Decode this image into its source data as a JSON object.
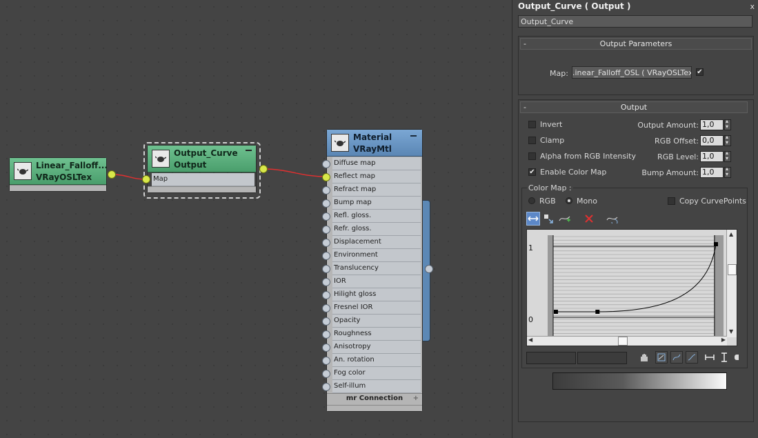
{
  "nodes": {
    "linear_falloff": {
      "title": "Linear_Falloff...",
      "subtitle": "VRayOSLTex"
    },
    "output_curve": {
      "title": "Output_Curve",
      "subtitle": "Output",
      "slots": [
        "Map"
      ]
    },
    "material": {
      "title": "Material",
      "subtitle": "VRayMtl",
      "slots": [
        "Diffuse map",
        "Reflect map",
        "Refract map",
        "Bump map",
        "Refl. gloss.",
        "Refr. gloss.",
        "Displacement",
        "Environment",
        "Translucency",
        "IOR",
        "Hilight gloss",
        "Fresnel IOR",
        "Opacity",
        "Roughness",
        "Anisotropy",
        "An. rotation",
        "Fog color",
        "Self-illum"
      ],
      "footer": "mr Connection",
      "footer_plus": "+"
    }
  },
  "panel": {
    "title": "Output_Curve  ( Output )",
    "close": "x",
    "name_value": "Output_Curve",
    "output_parameters": {
      "header": "Output Parameters",
      "collapse": "-",
      "map_label": "Map:",
      "map_value": ".inear_Falloff_OSL  ( VRayOSLTex )",
      "map_enabled": "✔"
    },
    "output": {
      "header": "Output",
      "collapse": "-",
      "checks": [
        {
          "label": "Invert",
          "checked": ""
        },
        {
          "label": "Clamp",
          "checked": ""
        },
        {
          "label": "Alpha from RGB Intensity",
          "checked": ""
        },
        {
          "label": "Enable Color Map",
          "checked": "✔"
        }
      ],
      "spinners": [
        {
          "label": "Output Amount:",
          "value": "1,0"
        },
        {
          "label": "RGB Offset:",
          "value": "0,0"
        },
        {
          "label": "RGB Level:",
          "value": "1,0"
        },
        {
          "label": "Bump Amount:",
          "value": "1,0"
        }
      ]
    },
    "color_map": {
      "label": "Color Map :",
      "rgb_label": "RGB",
      "mono_label": "Mono",
      "selected_mode": "Mono",
      "copy_label": "Copy CurvePoints",
      "y_top": "1",
      "y_bottom": "0",
      "curve_points": [
        [
          0.0,
          0.0
        ],
        [
          0.26,
          0.0
        ],
        [
          1.0,
          1.0
        ]
      ]
    }
  },
  "colors": {
    "wire": "#e03030",
    "node_green": "#5aae7c",
    "node_blue": "#5c88b5",
    "socket_active": "#d9e84a"
  }
}
